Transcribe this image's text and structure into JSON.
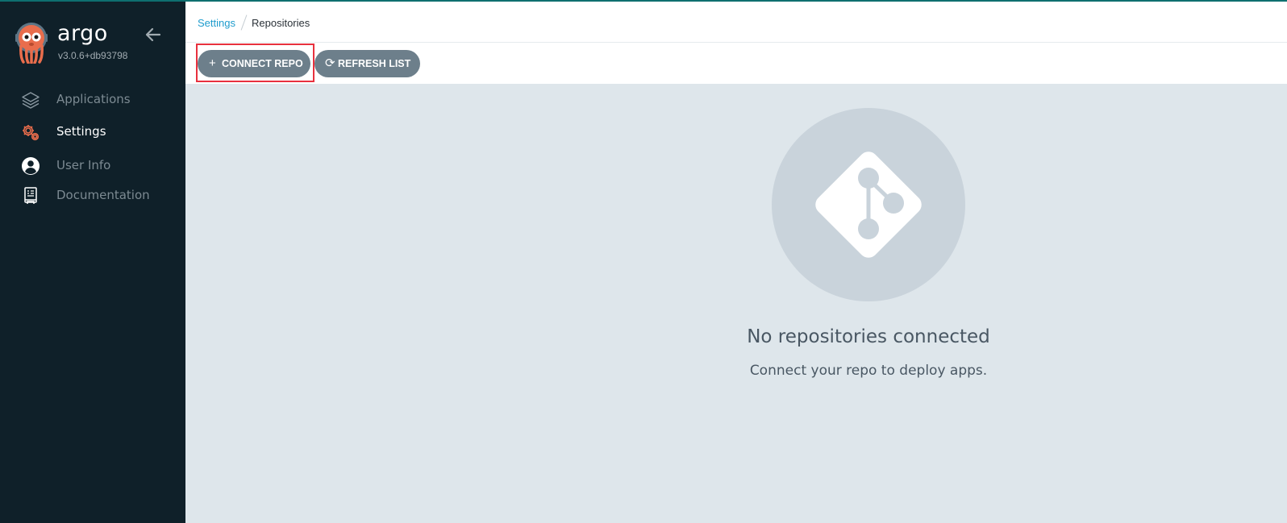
{
  "app": {
    "brand_name": "argo",
    "version": "v3.0.6+db93798"
  },
  "sidebar": {
    "items": [
      {
        "label": "Applications",
        "icon": "layers-icon",
        "active": false
      },
      {
        "label": "Settings",
        "icon": "gear-icon",
        "active": true
      },
      {
        "label": "User Info",
        "icon": "user-circle-icon",
        "active": false
      },
      {
        "label": "Documentation",
        "icon": "book-icon",
        "active": false
      }
    ]
  },
  "breadcrumb": {
    "parent": "Settings",
    "current": "Repositories"
  },
  "toolbar": {
    "connect_label": "CONNECT REPO",
    "refresh_label": "REFRESH LIST"
  },
  "empty_state": {
    "icon": "git-icon",
    "title": "No repositories connected",
    "subtitle": "Connect your repo to deploy apps."
  },
  "colors": {
    "sidebar_bg": "#0f2029",
    "accent_orange": "#e96d4c",
    "link_blue": "#1f9ccd",
    "button_gray": "#6d7f8b",
    "highlight_red": "#e8313e",
    "content_bg": "#dee6eb"
  }
}
